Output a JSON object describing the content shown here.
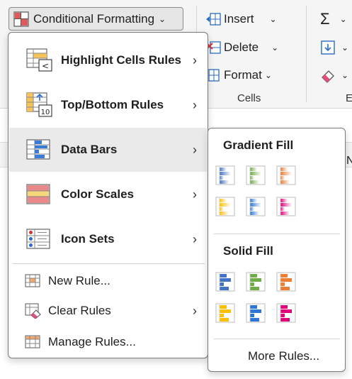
{
  "ribbon": {
    "conditional_formatting": "Conditional Formatting",
    "insert": "Insert",
    "delete": "Delete",
    "format": "Format",
    "cells_group": "Cells",
    "editing_group_partial": "E"
  },
  "sheet": {
    "column_letter_partial": "N"
  },
  "menu": {
    "items": [
      {
        "label": "Highlight Cells Rules",
        "icon": "highlight-cells-icon",
        "submenu": true
      },
      {
        "label": "Top/Bottom Rules",
        "icon": "top-bottom-icon",
        "submenu": true
      },
      {
        "label": "Data Bars",
        "icon": "data-bars-icon",
        "submenu": true,
        "active": true
      },
      {
        "label": "Color Scales",
        "icon": "color-scales-icon",
        "submenu": true
      },
      {
        "label": "Icon Sets",
        "icon": "icon-sets-icon",
        "submenu": true
      },
      {
        "label": "New Rule...",
        "icon": "new-rule-icon",
        "submenu": false
      },
      {
        "label": "Clear Rules",
        "icon": "clear-rules-icon",
        "submenu": true
      },
      {
        "label": "Manage Rules...",
        "icon": "manage-rules-icon",
        "submenu": false
      }
    ]
  },
  "submenu": {
    "gradient_heading": "Gradient Fill",
    "solid_heading": "Solid Fill",
    "more_rules": "More Rules...",
    "colors": [
      "#4472c4",
      "#70ad47",
      "#ed7d31",
      "#ffc000",
      "#2e75d6",
      "#e0007a"
    ]
  }
}
